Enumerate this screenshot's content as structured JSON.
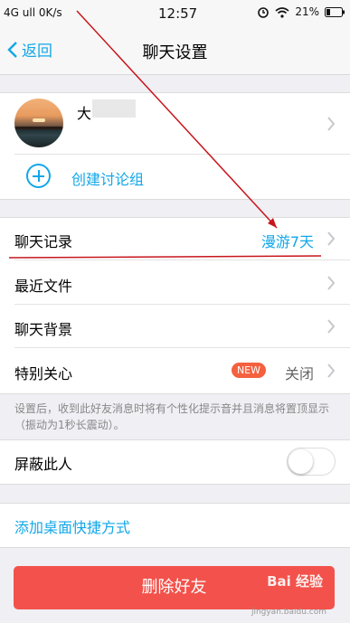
{
  "status_bar": {
    "left": "4G ull  0K/s",
    "time": "12:57",
    "battery": "21%"
  },
  "nav": {
    "back_label": "返回",
    "title": "聊天设置"
  },
  "friend": {
    "name": "大"
  },
  "create_group_label": "创建讨论组",
  "chat_history": {
    "label": "聊天记录",
    "value": "漫游7天"
  },
  "recent_files_label": "最近文件",
  "chat_background_label": "聊天背景",
  "special_care": {
    "label": "特别关心",
    "badge": "NEW",
    "value": "关闭"
  },
  "hint": "设置后，收到此好友消息时将有个性化提示音并且消息将置顶显示（振动为1秒长震动）。",
  "block_label": "屏蔽此人",
  "shortcut_label": "添加桌面快捷方式",
  "delete_label": "删除好友",
  "watermark": {
    "brand": "Bai  经验",
    "url": "jingyan.baidu.com"
  },
  "colors": {
    "accent": "#12a7e8",
    "delete": "#f2524b",
    "badge": "#f5603f",
    "annotation": "#c8161d"
  }
}
